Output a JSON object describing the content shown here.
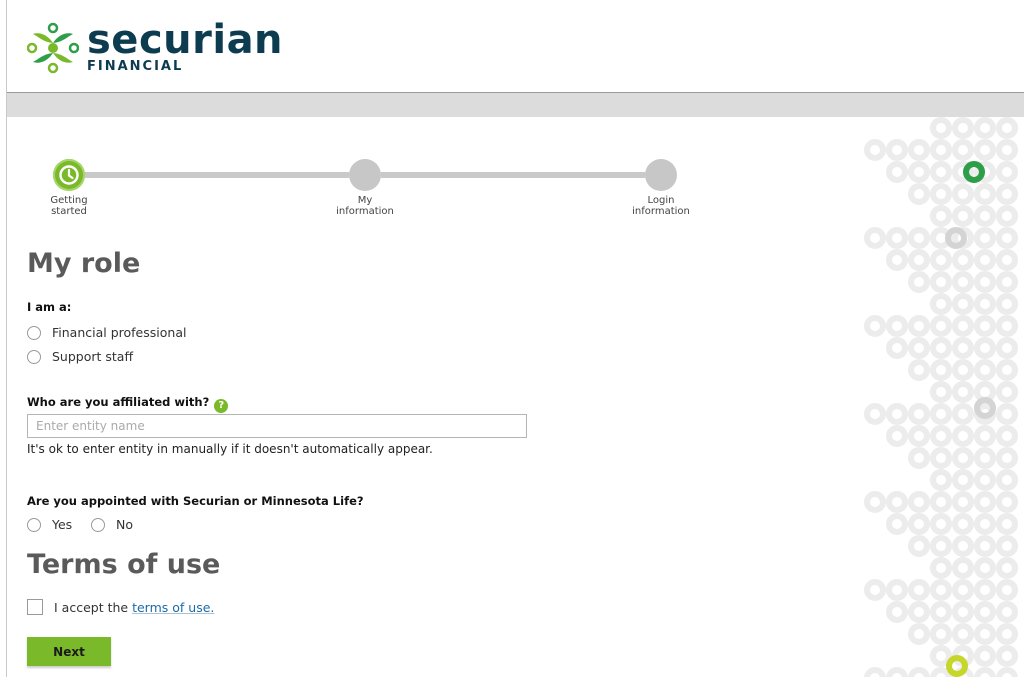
{
  "brand": {
    "name": "securian",
    "sub": "FINANCIAL",
    "colors": {
      "green": "#7ab929",
      "navy": "#0d3b4f"
    }
  },
  "progress": {
    "steps": [
      {
        "label_line1": "Getting",
        "label_line2": "started",
        "active": true
      },
      {
        "label_line1": "My",
        "label_line2": "information",
        "active": false
      },
      {
        "label_line1": "Login",
        "label_line2": "information",
        "active": false
      }
    ]
  },
  "role": {
    "heading": "My role",
    "question": "I am a:",
    "options": [
      "Financial professional",
      "Support staff"
    ]
  },
  "affiliation": {
    "question": "Who are you affiliated with?",
    "help_glyph": "?",
    "placeholder": "Enter entity name",
    "hint": "It's ok to enter entity in manually if it doesn't automatically appear."
  },
  "appointed": {
    "question": "Are you appointed with Securian or Minnesota Life?",
    "options": [
      "Yes",
      "No"
    ]
  },
  "terms": {
    "heading": "Terms of use",
    "accept_prefix": "I accept the",
    "accept_link": "terms of use."
  },
  "actions": {
    "next_label": "Next"
  }
}
